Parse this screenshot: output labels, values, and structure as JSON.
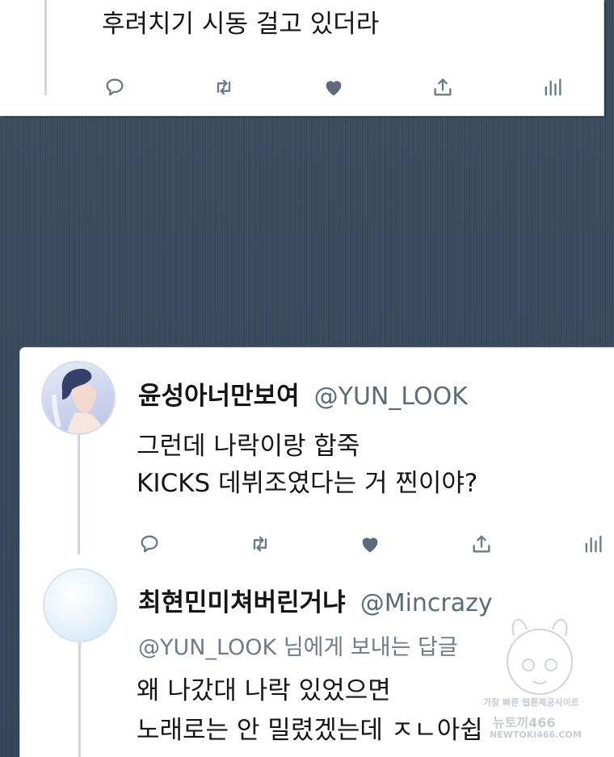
{
  "top_tweet": {
    "text": "후려치기 시동 걸고 있더라",
    "actions": [
      "reply-icon",
      "retweet-icon",
      "heart-icon",
      "share-icon",
      "analytics-icon"
    ]
  },
  "tweet_1": {
    "display_name": "윤성아너만보여",
    "handle": "@YUN_LOOK",
    "text_line1": "그런데 나락이랑 합죽",
    "text_line2": "KICKS 데뷔조였다는 거 찐이야?",
    "actions": [
      "reply-icon",
      "retweet-icon",
      "heart-icon",
      "share-icon",
      "analytics-icon"
    ]
  },
  "tweet_2": {
    "display_name": "최현민미쳐버린거냐",
    "handle": "@Mincrazy",
    "reply_to_handle": "@YUN_LOOK",
    "reply_to_suffix": " 님에게 보내는 답글",
    "text_line1": "왜 나갔대 나락 있었으면",
    "text_line2": "노래로는 안 밀렸겠는데 ㅈㄴ아쉽"
  },
  "watermark": {
    "line1": "가장 빠른 웹툰제공사이트",
    "line2": "뉴토끼466",
    "line3": "NEWTOKI466.COM"
  },
  "colors": {
    "icon_gray": "#6c7a87",
    "heart_fill": "#5b6b7b",
    "handle": "#5d6b78",
    "card_bg": "#ffffff",
    "background": "#3a4b5e"
  }
}
